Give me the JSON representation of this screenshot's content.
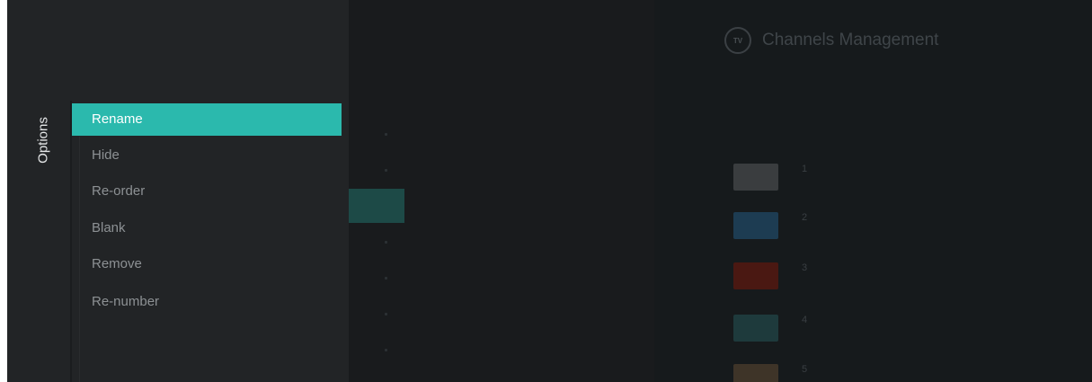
{
  "options_panel": {
    "title": "Options",
    "items": [
      {
        "label": "Rename",
        "selected": true
      },
      {
        "label": "Hide",
        "selected": false
      },
      {
        "label": "Re-order",
        "selected": false
      },
      {
        "label": "Blank",
        "selected": false
      },
      {
        "label": "Remove",
        "selected": false
      },
      {
        "label": "Re-number",
        "selected": false
      }
    ]
  },
  "channels_management": {
    "title": "Channels Management",
    "icon": "tv-icon",
    "channels": [
      {
        "number": "1",
        "name": "",
        "logo_color": "#3a3d3f"
      },
      {
        "number": "2",
        "name": "",
        "logo_color": "#1d3c52"
      },
      {
        "number": "3",
        "name": "",
        "logo_color": "#4a1812"
      },
      {
        "number": "4",
        "name": "",
        "logo_color": "#1e3a3c"
      },
      {
        "number": "5",
        "name": "",
        "logo_color": "#3e3428"
      }
    ]
  },
  "colors": {
    "accent": "#2bb9ad",
    "panel_bg": "#222426",
    "screen_bg": "#141618"
  }
}
